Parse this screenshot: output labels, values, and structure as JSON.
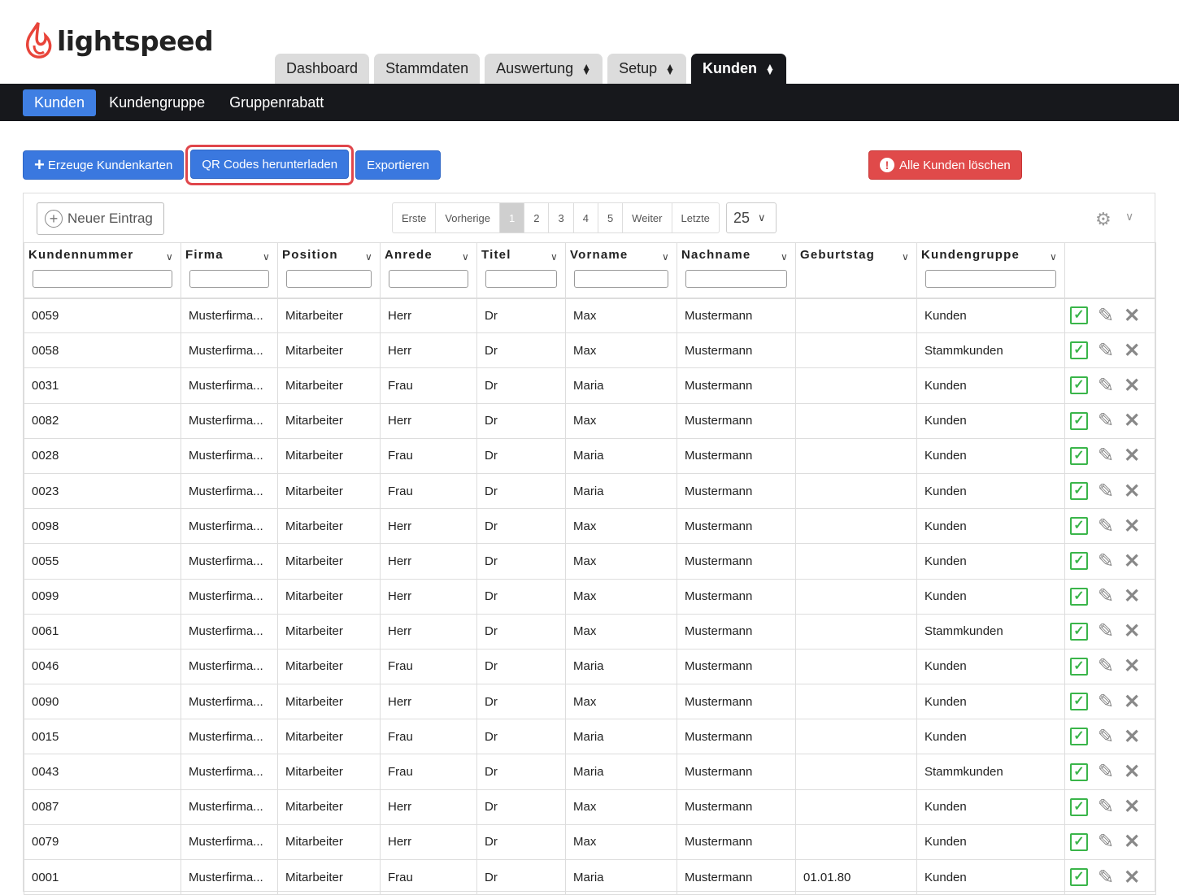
{
  "brand": {
    "name": "lightspeed",
    "color": "#e8443a"
  },
  "main_tabs": [
    {
      "label": "Dashboard",
      "dropdown": false
    },
    {
      "label": "Stammdaten",
      "dropdown": false
    },
    {
      "label": "Auswertung",
      "dropdown": true
    },
    {
      "label": "Setup",
      "dropdown": true
    },
    {
      "label": "Kunden",
      "dropdown": true,
      "active": true
    }
  ],
  "sub_nav": [
    {
      "label": "Kunden",
      "active": true
    },
    {
      "label": "Kundengruppe"
    },
    {
      "label": "Gruppenrabatt"
    }
  ],
  "actions": {
    "create_cards": "Erzeuge Kundenkarten",
    "qr_download": "QR Codes herunterladen",
    "export": "Exportieren",
    "delete_all": "Alle Kunden löschen"
  },
  "toolbar": {
    "new_entry": "Neuer Eintrag",
    "pager": [
      "Erste",
      "Vorherige",
      "1",
      "2",
      "3",
      "4",
      "5",
      "Weiter",
      "Letzte"
    ],
    "current_page": "1",
    "per_page": "25"
  },
  "columns": [
    "Kundennummer",
    "Firma",
    "Position",
    "Anrede",
    "Titel",
    "Vorname",
    "Nachname",
    "Geburtstag",
    "Kundengruppe"
  ],
  "rows": [
    [
      "0059",
      "Musterfirma...",
      "Mitarbeiter",
      "Herr",
      "Dr",
      "Max",
      "Mustermann",
      "",
      "Kunden"
    ],
    [
      "0058",
      "Musterfirma...",
      "Mitarbeiter",
      "Herr",
      "Dr",
      "Max",
      "Mustermann",
      "",
      "Stammkunden"
    ],
    [
      "0031",
      "Musterfirma...",
      "Mitarbeiter",
      "Frau",
      "Dr",
      "Maria",
      "Mustermann",
      "",
      "Kunden"
    ],
    [
      "0082",
      "Musterfirma...",
      "Mitarbeiter",
      "Herr",
      "Dr",
      "Max",
      "Mustermann",
      "",
      "Kunden"
    ],
    [
      "0028",
      "Musterfirma...",
      "Mitarbeiter",
      "Frau",
      "Dr",
      "Maria",
      "Mustermann",
      "",
      "Kunden"
    ],
    [
      "0023",
      "Musterfirma...",
      "Mitarbeiter",
      "Frau",
      "Dr",
      "Maria",
      "Mustermann",
      "",
      "Kunden"
    ],
    [
      "0098",
      "Musterfirma...",
      "Mitarbeiter",
      "Herr",
      "Dr",
      "Max",
      "Mustermann",
      "",
      "Kunden"
    ],
    [
      "0055",
      "Musterfirma...",
      "Mitarbeiter",
      "Herr",
      "Dr",
      "Max",
      "Mustermann",
      "",
      "Kunden"
    ],
    [
      "0099",
      "Musterfirma...",
      "Mitarbeiter",
      "Herr",
      "Dr",
      "Max",
      "Mustermann",
      "",
      "Kunden"
    ],
    [
      "0061",
      "Musterfirma...",
      "Mitarbeiter",
      "Herr",
      "Dr",
      "Max",
      "Mustermann",
      "",
      "Stammkunden"
    ],
    [
      "0046",
      "Musterfirma...",
      "Mitarbeiter",
      "Frau",
      "Dr",
      "Maria",
      "Mustermann",
      "",
      "Kunden"
    ],
    [
      "0090",
      "Musterfirma...",
      "Mitarbeiter",
      "Herr",
      "Dr",
      "Max",
      "Mustermann",
      "",
      "Kunden"
    ],
    [
      "0015",
      "Musterfirma...",
      "Mitarbeiter",
      "Frau",
      "Dr",
      "Maria",
      "Mustermann",
      "",
      "Kunden"
    ],
    [
      "0043",
      "Musterfirma...",
      "Mitarbeiter",
      "Frau",
      "Dr",
      "Maria",
      "Mustermann",
      "",
      "Stammkunden"
    ],
    [
      "0087",
      "Musterfirma...",
      "Mitarbeiter",
      "Herr",
      "Dr",
      "Max",
      "Mustermann",
      "",
      "Kunden"
    ],
    [
      "0079",
      "Musterfirma...",
      "Mitarbeiter",
      "Herr",
      "Dr",
      "Max",
      "Mustermann",
      "",
      "Kunden"
    ],
    [
      "0001",
      "Musterfirma...",
      "Mitarbeiter",
      "Frau",
      "Dr",
      "Maria",
      "Mustermann",
      "01.01.80",
      "Kunden"
    ]
  ],
  "row_actions": [
    "check-icon",
    "pencil-icon",
    "close-icon"
  ],
  "colors": {
    "accent": "#3a78df",
    "danger": "#e04a4a",
    "nav_dark": "#17181c",
    "ok": "#3ab54a"
  }
}
